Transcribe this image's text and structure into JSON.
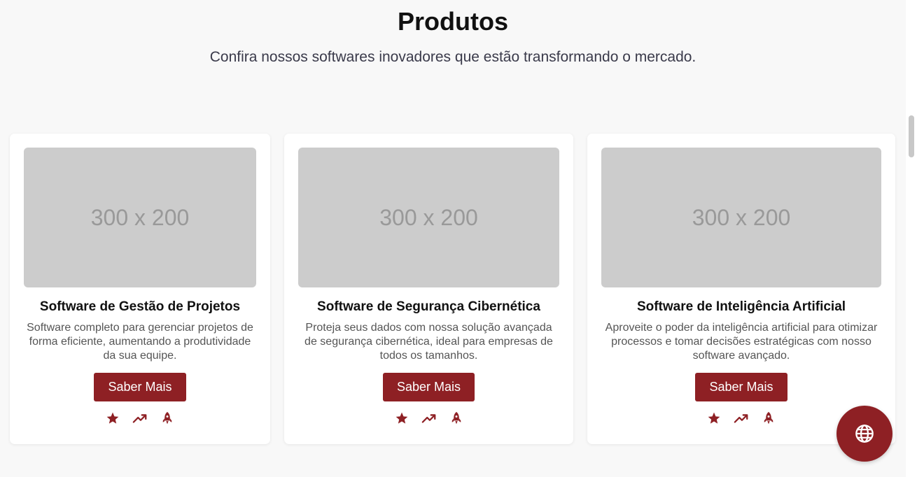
{
  "header": {
    "title": "Produtos",
    "subtitle": "Confira nossos softwares inovadores que estão transformando o mercado."
  },
  "products": [
    {
      "image_label": "300 x 200",
      "title": "Software de Gestão de Projetos",
      "description": "Software completo para gerenciar projetos de forma eficiente, aumentando a produtividade da sua equipe.",
      "button_label": "Saber Mais",
      "icons": [
        "star-icon",
        "trending-up-icon",
        "rocket-icon"
      ]
    },
    {
      "image_label": "300 x 200",
      "title": "Software de Segurança Cibernética",
      "description": "Proteja seus dados com nossa solução avançada de segurança cibernética, ideal para empresas de todos os tamanhos.",
      "button_label": "Saber Mais",
      "icons": [
        "star-icon",
        "trending-up-icon",
        "rocket-icon"
      ]
    },
    {
      "image_label": "300 x 200",
      "title": "Software de Inteligência Artificial",
      "description": "Aproveite o poder da inteligência artificial para otimizar processos e tomar decisões estratégicas com nosso software avançado.",
      "button_label": "Saber Mais",
      "icons": [
        "star-icon",
        "trending-up-icon",
        "rocket-icon"
      ]
    }
  ],
  "fab": {
    "icon": "globe-icon"
  },
  "colors": {
    "accent": "#8e2024",
    "background": "#f8f8f8",
    "card": "#ffffff",
    "placeholder": "#cccccc"
  }
}
